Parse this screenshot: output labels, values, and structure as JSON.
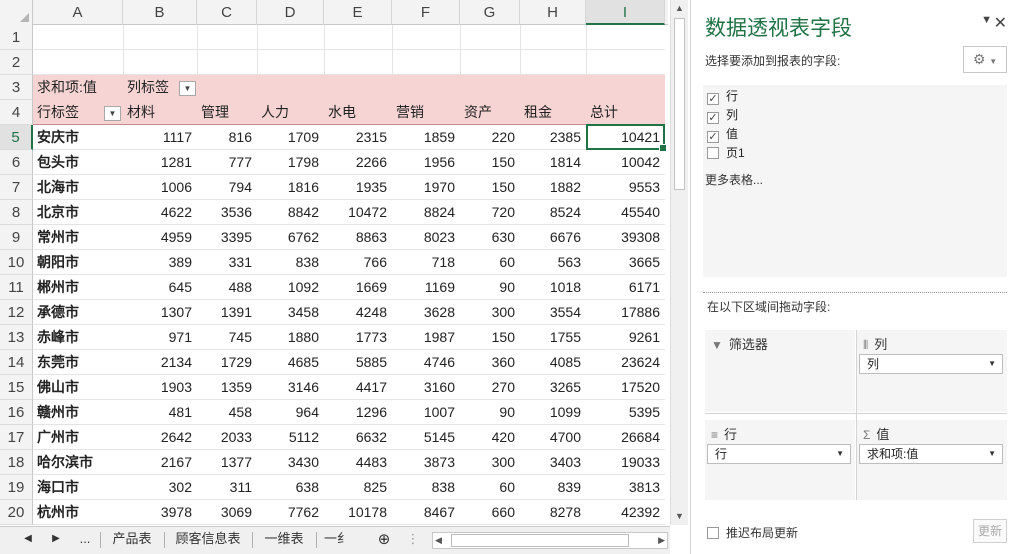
{
  "sheet": {
    "columns": [
      "A",
      "B",
      "C",
      "D",
      "E",
      "F",
      "G",
      "H",
      "I"
    ],
    "selected_column": "I",
    "selected_row": "5",
    "rows": [
      "1",
      "2",
      "3",
      "4",
      "5",
      "6",
      "7",
      "8",
      "9",
      "10",
      "11",
      "12",
      "13",
      "14",
      "15",
      "16",
      "17",
      "18",
      "19",
      "20"
    ],
    "pivot": {
      "values_label": "求和项:值",
      "col_labels_label": "列标签",
      "row_labels_label": "行标签",
      "headers": [
        "材料",
        "管理",
        "人力",
        "水电",
        "营销",
        "资产",
        "租金",
        "总计"
      ],
      "data": [
        [
          "安庆市",
          "1117",
          "816",
          "1709",
          "2315",
          "1859",
          "220",
          "2385",
          "10421"
        ],
        [
          "包头市",
          "1281",
          "777",
          "1798",
          "2266",
          "1956",
          "150",
          "1814",
          "10042"
        ],
        [
          "北海市",
          "1006",
          "794",
          "1816",
          "1935",
          "1970",
          "150",
          "1882",
          "9553"
        ],
        [
          "北京市",
          "4622",
          "3536",
          "8842",
          "10472",
          "8824",
          "720",
          "8524",
          "45540"
        ],
        [
          "常州市",
          "4959",
          "3395",
          "6762",
          "8863",
          "8023",
          "630",
          "6676",
          "39308"
        ],
        [
          "朝阳市",
          "389",
          "331",
          "838",
          "766",
          "718",
          "60",
          "563",
          "3665"
        ],
        [
          "郴州市",
          "645",
          "488",
          "1092",
          "1669",
          "1169",
          "90",
          "1018",
          "6171"
        ],
        [
          "承德市",
          "1307",
          "1391",
          "3458",
          "4248",
          "3628",
          "300",
          "3554",
          "17886"
        ],
        [
          "赤峰市",
          "971",
          "745",
          "1880",
          "1773",
          "1987",
          "150",
          "1755",
          "9261"
        ],
        [
          "东莞市",
          "2134",
          "1729",
          "4685",
          "5885",
          "4746",
          "360",
          "4085",
          "23624"
        ],
        [
          "佛山市",
          "1903",
          "1359",
          "3146",
          "4417",
          "3160",
          "270",
          "3265",
          "17520"
        ],
        [
          "赣州市",
          "481",
          "458",
          "964",
          "1296",
          "1007",
          "90",
          "1099",
          "5395"
        ],
        [
          "广州市",
          "2642",
          "2033",
          "5112",
          "6632",
          "5145",
          "420",
          "4700",
          "26684"
        ],
        [
          "哈尔滨市",
          "2167",
          "1377",
          "3430",
          "4483",
          "3873",
          "300",
          "3403",
          "19033"
        ],
        [
          "海口市",
          "302",
          "311",
          "638",
          "825",
          "838",
          "60",
          "839",
          "3813"
        ],
        [
          "杭州市",
          "3978",
          "3069",
          "7762",
          "10178",
          "8467",
          "660",
          "8278",
          "42392"
        ]
      ]
    },
    "tabs": [
      "产品表",
      "顾客信息表",
      "一维表",
      "一纟"
    ],
    "tab_more": "..."
  },
  "pane": {
    "title": "数据透视表字段",
    "subtitle": "选择要添加到报表的字段:",
    "fields": [
      {
        "label": "行",
        "checked": true
      },
      {
        "label": "列",
        "checked": true
      },
      {
        "label": "值",
        "checked": true
      },
      {
        "label": "页1",
        "checked": false
      }
    ],
    "more_tables": "更多表格...",
    "drag_label": "在以下区域间拖动字段:",
    "areas": {
      "filter": {
        "label": "筛选器"
      },
      "columns": {
        "label": "列",
        "value": "列"
      },
      "rows": {
        "label": "行",
        "value": "行"
      },
      "values": {
        "label": "值",
        "value": "求和项:值"
      }
    },
    "defer_label": "推迟布局更新",
    "update_label": "更新"
  }
}
